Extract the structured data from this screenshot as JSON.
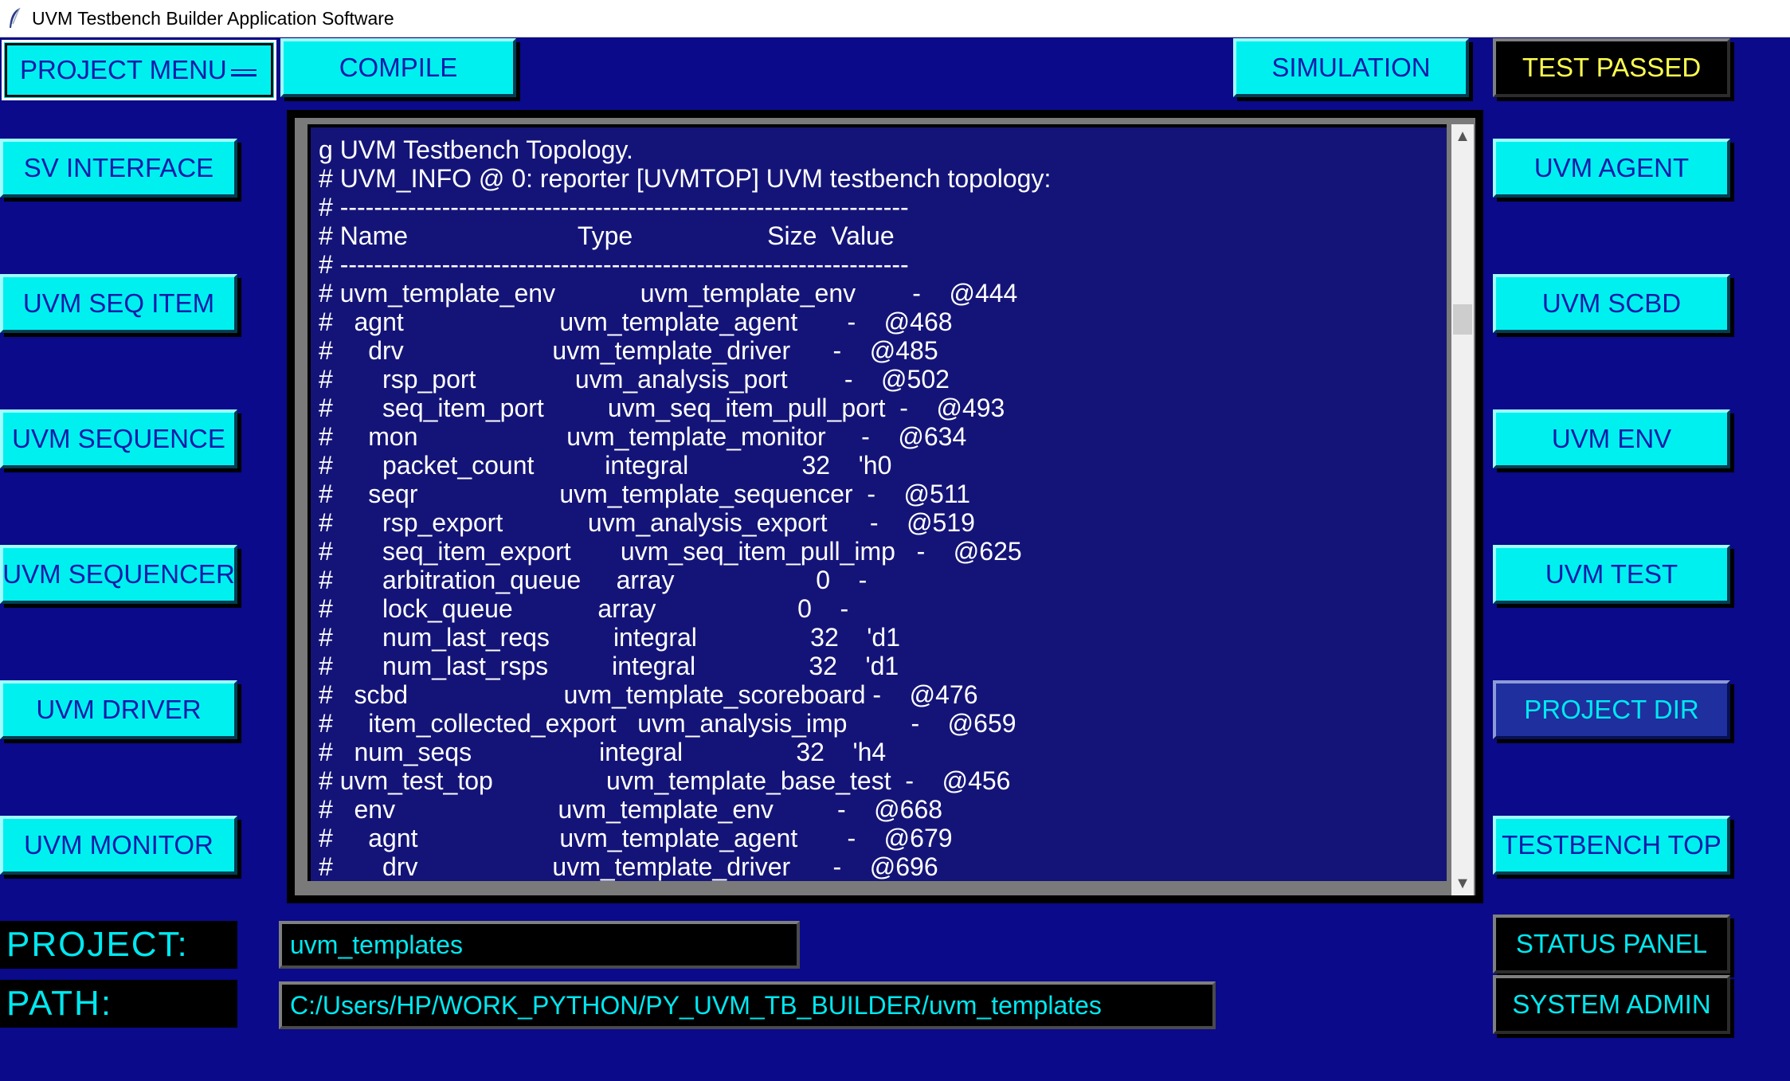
{
  "window": {
    "title": "UVM Testbench Builder Application Software"
  },
  "menu": {
    "project_menu": "PROJECT MENU"
  },
  "toolbar": {
    "compile": "COMPILE",
    "simulation": "SIMULATION",
    "status": "TEST PASSED"
  },
  "left_buttons": [
    "SV INTERFACE",
    "UVM SEQ ITEM",
    "UVM SEQUENCE",
    "UVM SEQUENCER",
    "UVM DRIVER",
    "UVM MONITOR"
  ],
  "right_buttons": [
    "UVM AGENT",
    "UVM SCBD",
    "UVM ENV",
    "UVM TEST",
    "PROJECT DIR",
    "TESTBENCH TOP"
  ],
  "bottom_right_buttons": [
    "STATUS PANEL",
    "SYSTEM ADMIN"
  ],
  "console": {
    "lines": [
      "g UVM Testbench Topology.",
      "# UVM_INFO @ 0: reporter [UVMTOP] UVM testbench topology:",
      "# -------------------------------------------------------------------",
      "# Name                        Type                   Size  Value",
      "# -------------------------------------------------------------------",
      "# uvm_template_env            uvm_template_env        -    @444",
      "#   agnt                      uvm_template_agent       -    @468",
      "#     drv                     uvm_template_driver      -    @485",
      "#       rsp_port              uvm_analysis_port        -    @502",
      "#       seq_item_port         uvm_seq_item_pull_port  -    @493",
      "#     mon                     uvm_template_monitor     -    @634",
      "#       packet_count          integral                32    'h0",
      "#     seqr                    uvm_template_sequencer  -    @511",
      "#       rsp_export            uvm_analysis_export      -    @519",
      "#       seq_item_export       uvm_seq_item_pull_imp   -    @625",
      "#       arbitration_queue     array                    0    -",
      "#       lock_queue            array                    0    -",
      "#       num_last_reqs         integral                32    'd1",
      "#       num_last_rsps         integral                32    'd1",
      "#   scbd                      uvm_template_scoreboard -    @476",
      "#     item_collected_export   uvm_analysis_imp         -    @659",
      "#   num_seqs                  integral                32    'h4",
      "# uvm_test_top                uvm_template_base_test  -    @456",
      "#   env                       uvm_template_env         -    @668",
      "#     agnt                    uvm_template_agent       -    @679",
      "#       drv                   uvm_template_driver      -    @696"
    ]
  },
  "fields": {
    "project_label": "PROJECT:",
    "project_value": "uvm_templates",
    "path_label": "PATH:",
    "path_value": "C:/Users/HP/WORK_PYTHON/PY_UVM_TB_BUILDER/uvm_templates"
  },
  "colors": {
    "background": "#0a0a8a",
    "button": "#00f0f0",
    "button_text": "#0a1ca8",
    "status_text": "#ffff4f",
    "console_bg": "#141478"
  }
}
